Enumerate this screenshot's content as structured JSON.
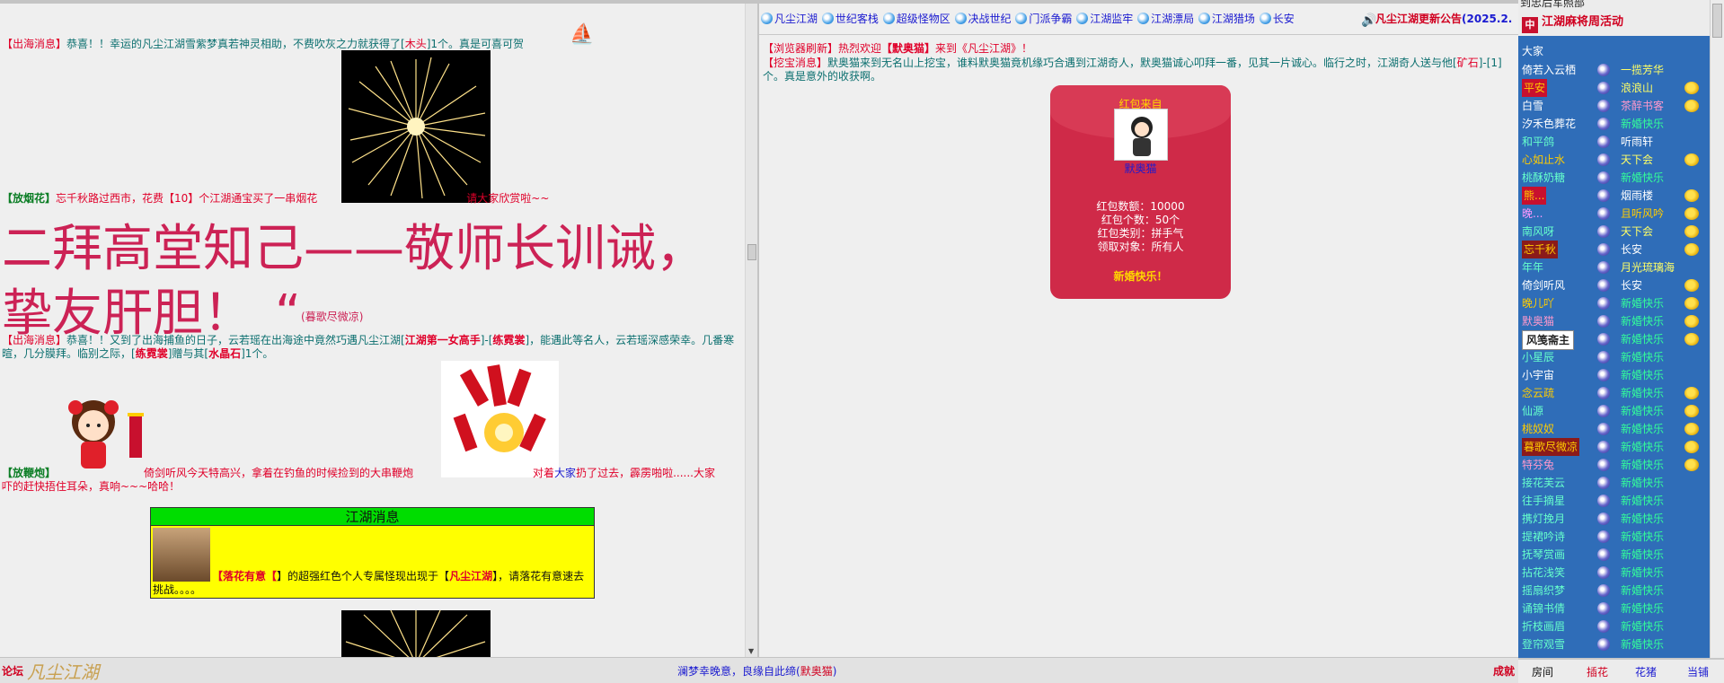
{
  "left": {
    "msg1": {
      "tag": "【出海消息】",
      "t1": "恭喜！！幸运的凡尘江湖雪紫梦真若神灵相助，不费吹灰之力就获得了[",
      "item": "木头",
      "t2": "]1个。真是可喜可贺"
    },
    "msg2": {
      "tag": "【放烟花】",
      "t1": "忘千秋路过西市，花费【10】个江湖通宝买了一串烟花",
      "t2": "请大家欣赏啦~~"
    },
    "bigtext": {
      "line": "二拜高堂知己——敬师长训诫，挚友肝胆！",
      "quote": "“",
      "sign": "(暮歌尽微凉)"
    },
    "msg3": {
      "tag": "【出海消息】",
      "t1": "恭喜！！又到了出海捕鱼的日子，云若瑶在出海途中竟然巧遇凡尘江湖[",
      "title": "江湖第一女高手",
      "t2": "]-[",
      "name": "练霓裳",
      "t3": "]，能遇此等名人，云若瑶深感荣幸。几番寒暄，几分膜拜。临别之际，[",
      "name2": "练霓裳",
      "t4": "]赠与其[",
      "gift": "水晶石",
      "t5": "]1个。"
    },
    "msg4": {
      "tag": "【放鞭炮】",
      "t1": "倚剑听风今天特高兴，拿着在钓鱼的时候捡到的大串鞭炮",
      "t2": "对着",
      "who": "大家",
      "t3": "扔了过去，霹雳啪啦......大家吓的赶快捂住耳朵，真响~~~哈哈！"
    },
    "jhbox": {
      "title": "江湖消息",
      "t1": "【",
      "name": "落花有意",
      "t2": "】的超强红色个人专属怪现出现于【",
      "place": "凡尘江湖",
      "t3": "】，请落花有意速去挑战。。。。"
    }
  },
  "mid": {
    "tabs": [
      "凡尘江湖",
      "世纪客栈",
      "超级怪物区",
      "决战世纪",
      "门派争霸",
      "江湖监牢",
      "江湖漂局",
      "江湖猎场",
      "长安"
    ],
    "notice": {
      "label": "凡尘江湖更新公告",
      "date": "(2025.2."
    },
    "msg1": {
      "tag": "【浏览器刷新】",
      "t1": "热烈欢迎",
      "name": "【默奥猫】",
      "t2": "来到《凡尘江湖》！"
    },
    "msg2": {
      "tag": "【挖宝消息】",
      "t1": "默奥猫来到无名山上挖宝，谁料默奥猫竟机缘巧合遇到江湖奇人，默奥猫诚心叩拜一番，见其一片诚心。临行之时，江湖奇人送与他[",
      "item": "矿石",
      "t2": "]-[1]个。真是意外的收获啊。"
    },
    "redpacket": {
      "from": "红包来自",
      "name": "默奥猫",
      "amount": "红包数额：10000",
      "count": "红包个数：50个",
      "type": "红包类别：拼手气",
      "target": "领取对象：所有人",
      "wish": "新婚快乐！"
    }
  },
  "right": {
    "top1": "到忠后军照部",
    "top2": "江湖麻将周活动",
    "header": "大家",
    "rows": [
      {
        "name": "倚若入云栖",
        "room": "一揽芳华",
        "nc": "#fff",
        "rc": "#ffff66",
        "emo": false
      },
      {
        "name": "平安",
        "room": "浪浪山",
        "nc": "#ffcc00",
        "rc": "#ffff66",
        "emo": true,
        "hl": true
      },
      {
        "name": "白雪",
        "room": "茶醉书客",
        "nc": "#fff",
        "rc": "#ff99cc",
        "emo": true
      },
      {
        "name": "汐禾色葬花",
        "room": "新婚快乐",
        "nc": "#fff",
        "rc": "#33ff99",
        "emo": false
      },
      {
        "name": "和平鸽",
        "room": "听雨轩",
        "nc": "#66ffcc",
        "rc": "#fff",
        "emo": false
      },
      {
        "name": "心如止水",
        "room": "天下会",
        "nc": "#ffcc00",
        "rc": "#ffff66",
        "emo": true
      },
      {
        "name": "桃酥奶糖",
        "room": "新婚快乐",
        "nc": "#66ffcc",
        "rc": "#33ff99",
        "emo": false
      },
      {
        "name": "熊...",
        "room": "烟雨楼",
        "nc": "#ffcc00",
        "rc": "#fff",
        "emo": true,
        "hl": true
      },
      {
        "name": "晚...",
        "room": "且听风吟",
        "nc": "#ff99ff",
        "rc": "#ffcc00",
        "emo": true
      },
      {
        "name": "南风呀",
        "room": "天下会",
        "nc": "#66ffcc",
        "rc": "#ffff66",
        "emo": true
      },
      {
        "name": "忘千秋",
        "room": "长安",
        "nc": "#ffcc00",
        "rc": "#fff",
        "emo": true,
        "hl2": true
      },
      {
        "name": "年年",
        "room": "月光琉璃海",
        "nc": "#66ffcc",
        "rc": "#ffff66",
        "emo": false
      },
      {
        "name": "倚剑听风",
        "room": "长安",
        "nc": "#fff",
        "rc": "#fff",
        "emo": true
      },
      {
        "name": "晚儿吖",
        "room": "新婚快乐",
        "nc": "#ffcc00",
        "rc": "#33ff99",
        "emo": true
      },
      {
        "name": "默奥猫",
        "room": "新婚快乐",
        "nc": "#ff99cc",
        "rc": "#33ff99",
        "emo": true
      },
      {
        "name": "风笺斋主",
        "room": "新婚快乐",
        "nc": "#222",
        "rc": "#33ff99",
        "emo": true,
        "badge": true
      },
      {
        "name": "小星辰",
        "room": "新婚快乐",
        "nc": "#66ffcc",
        "rc": "#33ff99",
        "emo": false
      },
      {
        "name": "小宇宙",
        "room": "新婚快乐",
        "nc": "#fff",
        "rc": "#33ff99",
        "emo": false
      },
      {
        "name": "念云疏",
        "room": "新婚快乐",
        "nc": "#ffcc00",
        "rc": "#33ff99",
        "emo": true
      },
      {
        "name": "仙源",
        "room": "新婚快乐",
        "nc": "#66ffcc",
        "rc": "#33ff99",
        "emo": true
      },
      {
        "name": "桃奴奴",
        "room": "新婚快乐",
        "nc": "#ffcc00",
        "rc": "#33ff99",
        "emo": true
      },
      {
        "name": "暮歌尽微凉",
        "room": "新婚快乐",
        "nc": "#ffcc00",
        "rc": "#33ff99",
        "emo": true,
        "hl2": true
      },
      {
        "name": "特芬兔",
        "room": "新婚快乐",
        "nc": "#ff99cc",
        "rc": "#33ff99",
        "emo": true
      },
      {
        "name": "接花芙云",
        "room": "新婚快乐",
        "nc": "#66ffcc",
        "rc": "#33ff99",
        "emo": false
      },
      {
        "name": "往手摘星",
        "room": "新婚快乐",
        "nc": "#66ffcc",
        "rc": "#33ff99",
        "emo": false
      },
      {
        "name": "携灯挽月",
        "room": "新婚快乐",
        "nc": "#66ffcc",
        "rc": "#33ff99",
        "emo": false
      },
      {
        "name": "提裙吟诗",
        "room": "新婚快乐",
        "nc": "#66ffcc",
        "rc": "#33ff99",
        "emo": false
      },
      {
        "name": "抚琴赏画",
        "room": "新婚快乐",
        "nc": "#66ffcc",
        "rc": "#33ff99",
        "emo": false
      },
      {
        "name": "拈花浅笑",
        "room": "新婚快乐",
        "nc": "#66ffcc",
        "rc": "#33ff99",
        "emo": false
      },
      {
        "name": "摇扇织梦",
        "room": "新婚快乐",
        "nc": "#66ffcc",
        "rc": "#33ff99",
        "emo": false
      },
      {
        "name": "诵锦书倩",
        "room": "新婚快乐",
        "nc": "#66ffcc",
        "rc": "#33ff99",
        "emo": false
      },
      {
        "name": "折枝画眉",
        "room": "新婚快乐",
        "nc": "#66ffcc",
        "rc": "#33ff99",
        "emo": false
      },
      {
        "name": "登帘观雪",
        "room": "新婚快乐",
        "nc": "#66ffcc",
        "rc": "#33ff99",
        "emo": false
      }
    ],
    "buttons": [
      "房间",
      "插花",
      "花猪",
      "当铺"
    ]
  },
  "footer": {
    "forum": "论坛",
    "logo": "凡尘江湖",
    "t1": "澜梦幸晚意，良缘自此缔(",
    "name": "默奥猫",
    "t2": ")",
    "done": "成就"
  }
}
